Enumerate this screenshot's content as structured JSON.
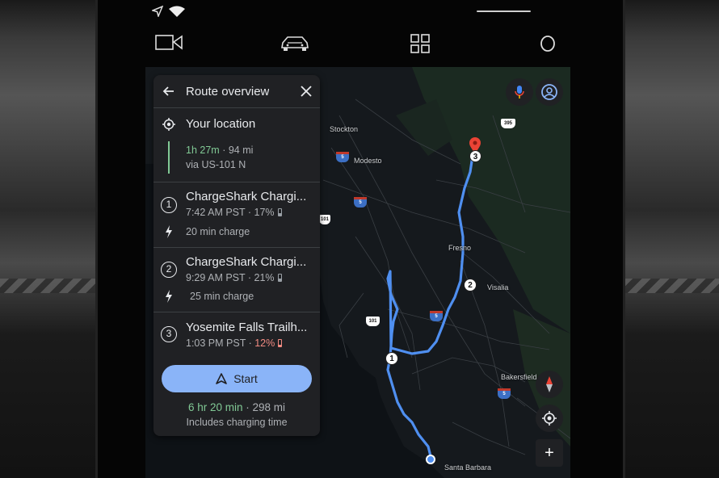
{
  "topbar": {
    "icons": [
      "video-camera-icon",
      "car-icon",
      "app-grid-icon",
      "home-circle-icon"
    ]
  },
  "map": {
    "cities": {
      "stockton": "Stockton",
      "modesto": "Modesto",
      "fresno": "Fresno",
      "visalia": "Visalia",
      "bakersfield": "Bakersfield",
      "santa_barbara": "Santa Barbara"
    },
    "shields": {
      "i5_a": "5",
      "i5_b": "5",
      "i5_c": "5",
      "i5_d": "5",
      "us395": "395",
      "us101_a": "101",
      "us101_b": "101"
    },
    "stops": [
      "1",
      "2",
      "3"
    ],
    "zoom_in_label": "+",
    "route_color": "#4f8ff0"
  },
  "card": {
    "title": "Route overview",
    "origin": {
      "label": "Your location",
      "duration": "1h 27m",
      "distance": "· 94 mi",
      "via": "via US-101 N"
    },
    "stops": [
      {
        "number": "1",
        "name": "ChargeShark Chargi...",
        "eta": "7:42 AM PST · ",
        "battery": "17%",
        "charge": "20 min charge"
      },
      {
        "number": "2",
        "name": "ChargeShark Chargi...",
        "eta": "9:29 AM PST · ",
        "battery": "21%",
        "charge": "25 min charge"
      },
      {
        "number": "3",
        "name": "Yosemite Falls Trailh...",
        "eta": "1:03 PM PST · ",
        "battery": "12%"
      }
    ],
    "start_label": "Start",
    "total_duration": "6 hr 20 min",
    "total_distance": "· 298 mi",
    "total_note": "Includes charging time"
  }
}
